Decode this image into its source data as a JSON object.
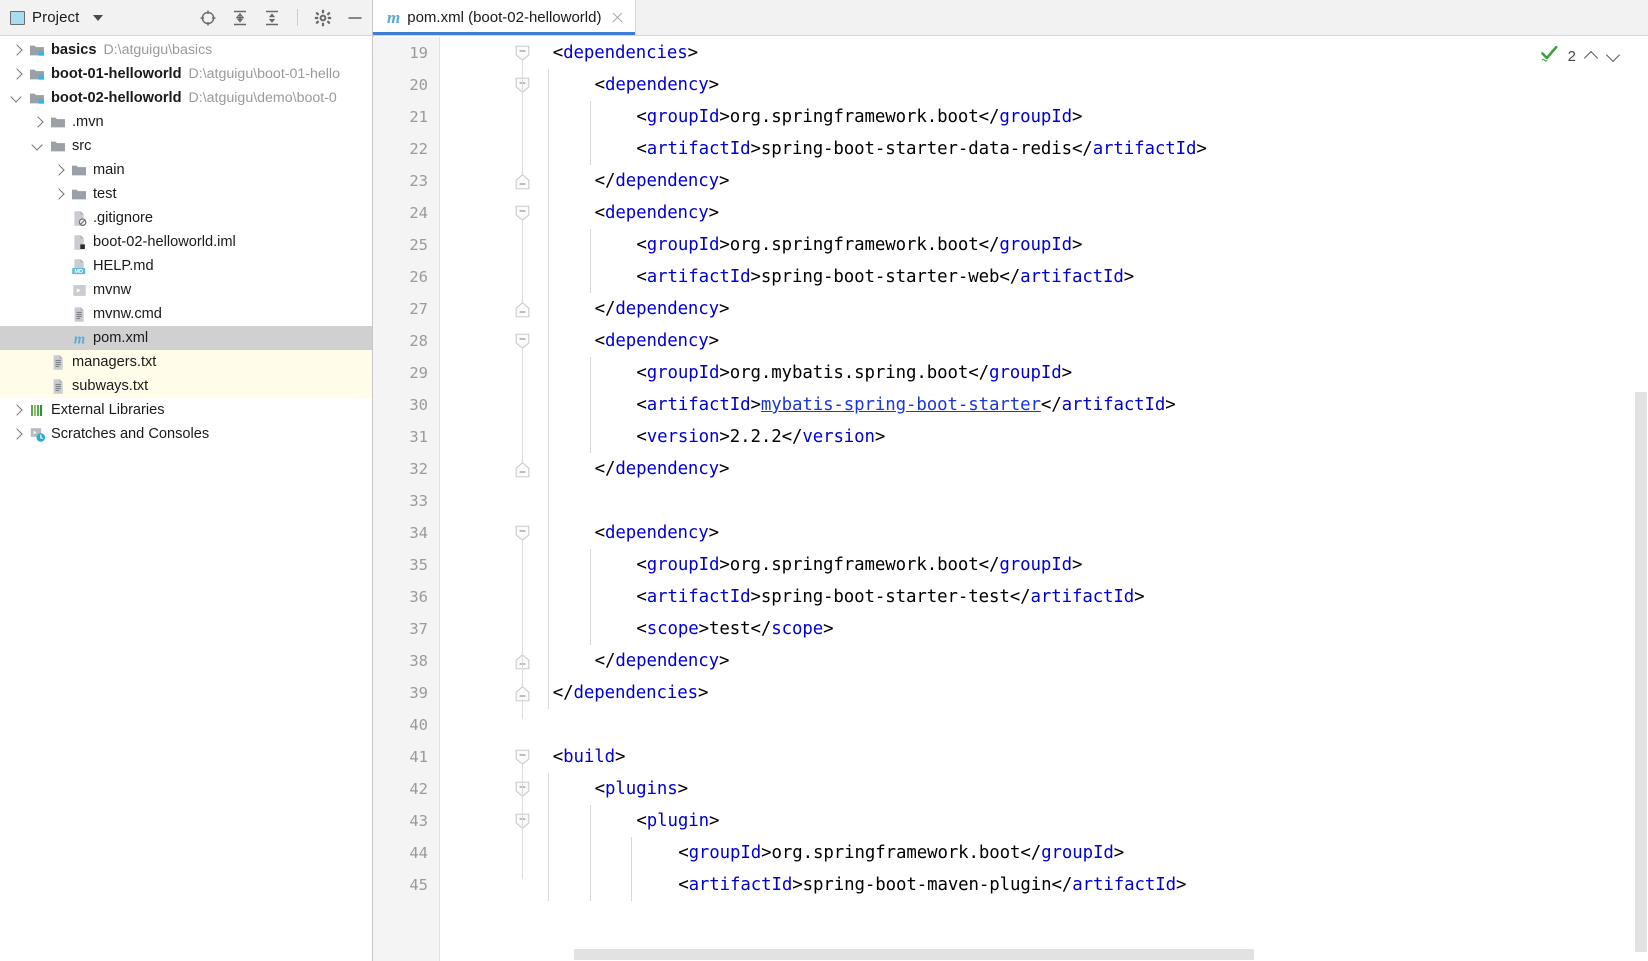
{
  "project_panel": {
    "title": "Project",
    "icons": [
      {
        "name": "locate-target-icon",
        "label": "Select Opened File"
      },
      {
        "name": "expand-all-icon",
        "label": "Expand All"
      },
      {
        "name": "collapse-all-icon",
        "label": "Collapse All"
      },
      {
        "name": "gear-icon",
        "label": "Settings"
      },
      {
        "name": "minimize-icon",
        "label": "Hide"
      }
    ],
    "tree": [
      {
        "label": "basics",
        "path": "D:\\atguigu\\basics",
        "indent": 0,
        "arrow": "closed",
        "icon": "module-folder-icon",
        "bold": true,
        "state": "normal"
      },
      {
        "label": "boot-01-helloworld",
        "path": "D:\\atguigu\\boot-01-hello",
        "indent": 0,
        "arrow": "closed",
        "icon": "module-folder-icon",
        "bold": true,
        "state": "normal"
      },
      {
        "label": "boot-02-helloworld",
        "path": "D:\\atguigu\\demo\\boot-0",
        "indent": 0,
        "arrow": "open",
        "icon": "module-folder-icon",
        "bold": true,
        "state": "normal"
      },
      {
        "label": ".mvn",
        "path": "",
        "indent": 1,
        "arrow": "closed",
        "icon": "folder-icon",
        "bold": false,
        "state": "normal"
      },
      {
        "label": "src",
        "path": "",
        "indent": 1,
        "arrow": "open",
        "icon": "folder-icon",
        "bold": false,
        "state": "normal"
      },
      {
        "label": "main",
        "path": "",
        "indent": 2,
        "arrow": "closed",
        "icon": "folder-icon",
        "bold": false,
        "state": "normal"
      },
      {
        "label": "test",
        "path": "",
        "indent": 2,
        "arrow": "closed",
        "icon": "folder-icon",
        "bold": false,
        "state": "normal"
      },
      {
        "label": ".gitignore",
        "path": "",
        "indent": 2,
        "arrow": "none",
        "icon": "gitignore-file-icon",
        "bold": false,
        "state": "normal"
      },
      {
        "label": "boot-02-helloworld.iml",
        "path": "",
        "indent": 2,
        "arrow": "none",
        "icon": "iml-file-icon",
        "bold": false,
        "state": "normal"
      },
      {
        "label": "HELP.md",
        "path": "",
        "indent": 2,
        "arrow": "none",
        "icon": "markdown-file-icon",
        "bold": false,
        "state": "normal"
      },
      {
        "label": "mvnw",
        "path": "",
        "indent": 2,
        "arrow": "none",
        "icon": "script-file-icon",
        "bold": false,
        "state": "normal"
      },
      {
        "label": "mvnw.cmd",
        "path": "",
        "indent": 2,
        "arrow": "none",
        "icon": "text-file-icon",
        "bold": false,
        "state": "normal"
      },
      {
        "label": "pom.xml",
        "path": "",
        "indent": 2,
        "arrow": "none",
        "icon": "maven-file-icon",
        "bold": false,
        "state": "selected"
      },
      {
        "label": "managers.txt",
        "path": "",
        "indent": 1,
        "arrow": "none",
        "icon": "text-file-icon",
        "bold": false,
        "state": "highlighted"
      },
      {
        "label": "subways.txt",
        "path": "",
        "indent": 1,
        "arrow": "none",
        "icon": "text-file-icon",
        "bold": false,
        "state": "highlighted"
      },
      {
        "label": "External Libraries",
        "path": "",
        "indent": 0,
        "arrow": "closed",
        "icon": "libraries-icon",
        "bold": false,
        "state": "normal"
      },
      {
        "label": "Scratches and Consoles",
        "path": "",
        "indent": 0,
        "arrow": "closed",
        "icon": "scratches-icon",
        "bold": false,
        "state": "normal"
      }
    ]
  },
  "editor": {
    "tab": {
      "icon": "maven-file-icon",
      "title": "pom.xml (boot-02-helloworld)",
      "close_label": "Close",
      "active": true
    },
    "inspection": {
      "icon": "inspection-ok-icon",
      "count": "2",
      "prev_label": "Previous Highlighted Error",
      "next_label": "Next Highlighted Error"
    },
    "first_line_number": 19,
    "colors": {
      "tag": "#0000d0",
      "text": "#000000",
      "link": "#1a37d8",
      "gutter_bg": "#f4f4f4",
      "line_number": "#9a9a9a",
      "tab_underline": "#3e7fd5",
      "selection": "#d0d0d0",
      "highlight_row": "#fffdea",
      "check_green": "#3f9c3f"
    },
    "lines": [
      {
        "n": 19,
        "indent": 1,
        "fold": "open",
        "tokens": [
          {
            "t": "<",
            "c": "p"
          },
          {
            "t": "dependencies",
            "c": "tag"
          },
          {
            "t": ">",
            "c": "p"
          }
        ]
      },
      {
        "n": 20,
        "indent": 2,
        "fold": "open",
        "tokens": [
          {
            "t": "<",
            "c": "p"
          },
          {
            "t": "dependency",
            "c": "tag"
          },
          {
            "t": ">",
            "c": "p"
          }
        ]
      },
      {
        "n": 21,
        "indent": 3,
        "fold": "none",
        "tokens": [
          {
            "t": "<",
            "c": "p"
          },
          {
            "t": "groupId",
            "c": "tag"
          },
          {
            "t": ">org.springframework.boot</",
            "c": "p"
          },
          {
            "t": "groupId",
            "c": "tag"
          },
          {
            "t": ">",
            "c": "p"
          }
        ]
      },
      {
        "n": 22,
        "indent": 3,
        "fold": "none",
        "tokens": [
          {
            "t": "<",
            "c": "p"
          },
          {
            "t": "artifactId",
            "c": "tag"
          },
          {
            "t": ">spring-boot-starter-data-redis</",
            "c": "p"
          },
          {
            "t": "artifactId",
            "c": "tag"
          },
          {
            "t": ">",
            "c": "p"
          }
        ]
      },
      {
        "n": 23,
        "indent": 2,
        "fold": "close",
        "tokens": [
          {
            "t": "</",
            "c": "p"
          },
          {
            "t": "dependency",
            "c": "tag"
          },
          {
            "t": ">",
            "c": "p"
          }
        ]
      },
      {
        "n": 24,
        "indent": 2,
        "fold": "open",
        "tokens": [
          {
            "t": "<",
            "c": "p"
          },
          {
            "t": "dependency",
            "c": "tag"
          },
          {
            "t": ">",
            "c": "p"
          }
        ]
      },
      {
        "n": 25,
        "indent": 3,
        "fold": "none",
        "tokens": [
          {
            "t": "<",
            "c": "p"
          },
          {
            "t": "groupId",
            "c": "tag"
          },
          {
            "t": ">org.springframework.boot</",
            "c": "p"
          },
          {
            "t": "groupId",
            "c": "tag"
          },
          {
            "t": ">",
            "c": "p"
          }
        ]
      },
      {
        "n": 26,
        "indent": 3,
        "fold": "none",
        "tokens": [
          {
            "t": "<",
            "c": "p"
          },
          {
            "t": "artifactId",
            "c": "tag"
          },
          {
            "t": ">spring-boot-starter-web</",
            "c": "p"
          },
          {
            "t": "artifactId",
            "c": "tag"
          },
          {
            "t": ">",
            "c": "p"
          }
        ]
      },
      {
        "n": 27,
        "indent": 2,
        "fold": "close",
        "tokens": [
          {
            "t": "</",
            "c": "p"
          },
          {
            "t": "dependency",
            "c": "tag"
          },
          {
            "t": ">",
            "c": "p"
          }
        ]
      },
      {
        "n": 28,
        "indent": 2,
        "fold": "open",
        "tokens": [
          {
            "t": "<",
            "c": "p"
          },
          {
            "t": "dependency",
            "c": "tag"
          },
          {
            "t": ">",
            "c": "p"
          }
        ]
      },
      {
        "n": 29,
        "indent": 3,
        "fold": "none",
        "tokens": [
          {
            "t": "<",
            "c": "p"
          },
          {
            "t": "groupId",
            "c": "tag"
          },
          {
            "t": ">org.mybatis.spring.boot</",
            "c": "p"
          },
          {
            "t": "groupId",
            "c": "tag"
          },
          {
            "t": ">",
            "c": "p"
          }
        ]
      },
      {
        "n": 30,
        "indent": 3,
        "fold": "none",
        "tokens": [
          {
            "t": "<",
            "c": "p"
          },
          {
            "t": "artifactId",
            "c": "tag"
          },
          {
            "t": ">",
            "c": "p"
          },
          {
            "t": "mybatis-spring-boot-starter",
            "c": "link"
          },
          {
            "t": "</",
            "c": "p"
          },
          {
            "t": "artifactId",
            "c": "tag"
          },
          {
            "t": ">",
            "c": "p"
          }
        ]
      },
      {
        "n": 31,
        "indent": 3,
        "fold": "none",
        "tokens": [
          {
            "t": "<",
            "c": "p"
          },
          {
            "t": "version",
            "c": "tag"
          },
          {
            "t": ">2.2.2</",
            "c": "p"
          },
          {
            "t": "version",
            "c": "tag"
          },
          {
            "t": ">",
            "c": "p"
          }
        ]
      },
      {
        "n": 32,
        "indent": 2,
        "fold": "close",
        "tokens": [
          {
            "t": "</",
            "c": "p"
          },
          {
            "t": "dependency",
            "c": "tag"
          },
          {
            "t": ">",
            "c": "p"
          }
        ]
      },
      {
        "n": 33,
        "indent": 0,
        "fold": "none",
        "tokens": []
      },
      {
        "n": 34,
        "indent": 2,
        "fold": "open",
        "tokens": [
          {
            "t": "<",
            "c": "p"
          },
          {
            "t": "dependency",
            "c": "tag"
          },
          {
            "t": ">",
            "c": "p"
          }
        ]
      },
      {
        "n": 35,
        "indent": 3,
        "fold": "none",
        "tokens": [
          {
            "t": "<",
            "c": "p"
          },
          {
            "t": "groupId",
            "c": "tag"
          },
          {
            "t": ">org.springframework.boot</",
            "c": "p"
          },
          {
            "t": "groupId",
            "c": "tag"
          },
          {
            "t": ">",
            "c": "p"
          }
        ]
      },
      {
        "n": 36,
        "indent": 3,
        "fold": "none",
        "tokens": [
          {
            "t": "<",
            "c": "p"
          },
          {
            "t": "artifactId",
            "c": "tag"
          },
          {
            "t": ">spring-boot-starter-test</",
            "c": "p"
          },
          {
            "t": "artifactId",
            "c": "tag"
          },
          {
            "t": ">",
            "c": "p"
          }
        ]
      },
      {
        "n": 37,
        "indent": 3,
        "fold": "none",
        "tokens": [
          {
            "t": "<",
            "c": "p"
          },
          {
            "t": "scope",
            "c": "tag"
          },
          {
            "t": ">test</",
            "c": "p"
          },
          {
            "t": "scope",
            "c": "tag"
          },
          {
            "t": ">",
            "c": "p"
          }
        ]
      },
      {
        "n": 38,
        "indent": 2,
        "fold": "close",
        "tokens": [
          {
            "t": "</",
            "c": "p"
          },
          {
            "t": "dependency",
            "c": "tag"
          },
          {
            "t": ">",
            "c": "p"
          }
        ]
      },
      {
        "n": 39,
        "indent": 1,
        "fold": "close",
        "tokens": [
          {
            "t": "</",
            "c": "p"
          },
          {
            "t": "dependencies",
            "c": "tag"
          },
          {
            "t": ">",
            "c": "p"
          }
        ]
      },
      {
        "n": 40,
        "indent": 0,
        "fold": "none",
        "tokens": []
      },
      {
        "n": 41,
        "indent": 1,
        "fold": "open",
        "tokens": [
          {
            "t": "<",
            "c": "p"
          },
          {
            "t": "build",
            "c": "tag"
          },
          {
            "t": ">",
            "c": "p"
          }
        ]
      },
      {
        "n": 42,
        "indent": 2,
        "fold": "open",
        "tokens": [
          {
            "t": "<",
            "c": "p"
          },
          {
            "t": "plugins",
            "c": "tag"
          },
          {
            "t": ">",
            "c": "p"
          }
        ]
      },
      {
        "n": 43,
        "indent": 3,
        "fold": "open",
        "tokens": [
          {
            "t": "<",
            "c": "p"
          },
          {
            "t": "plugin",
            "c": "tag"
          },
          {
            "t": ">",
            "c": "p"
          }
        ]
      },
      {
        "n": 44,
        "indent": 4,
        "fold": "none",
        "tokens": [
          {
            "t": "<",
            "c": "p"
          },
          {
            "t": "groupId",
            "c": "tag"
          },
          {
            "t": ">org.springframework.boot</",
            "c": "p"
          },
          {
            "t": "groupId",
            "c": "tag"
          },
          {
            "t": ">",
            "c": "p"
          }
        ]
      },
      {
        "n": 45,
        "indent": 4,
        "fold": "none",
        "tokens": [
          {
            "t": "<",
            "c": "p"
          },
          {
            "t": "artifactId",
            "c": "tag"
          },
          {
            "t": ">spring-boot-maven-plugin</",
            "c": "p"
          },
          {
            "t": "artifactId",
            "c": "tag"
          },
          {
            "t": ">",
            "c": "p"
          }
        ]
      }
    ]
  }
}
